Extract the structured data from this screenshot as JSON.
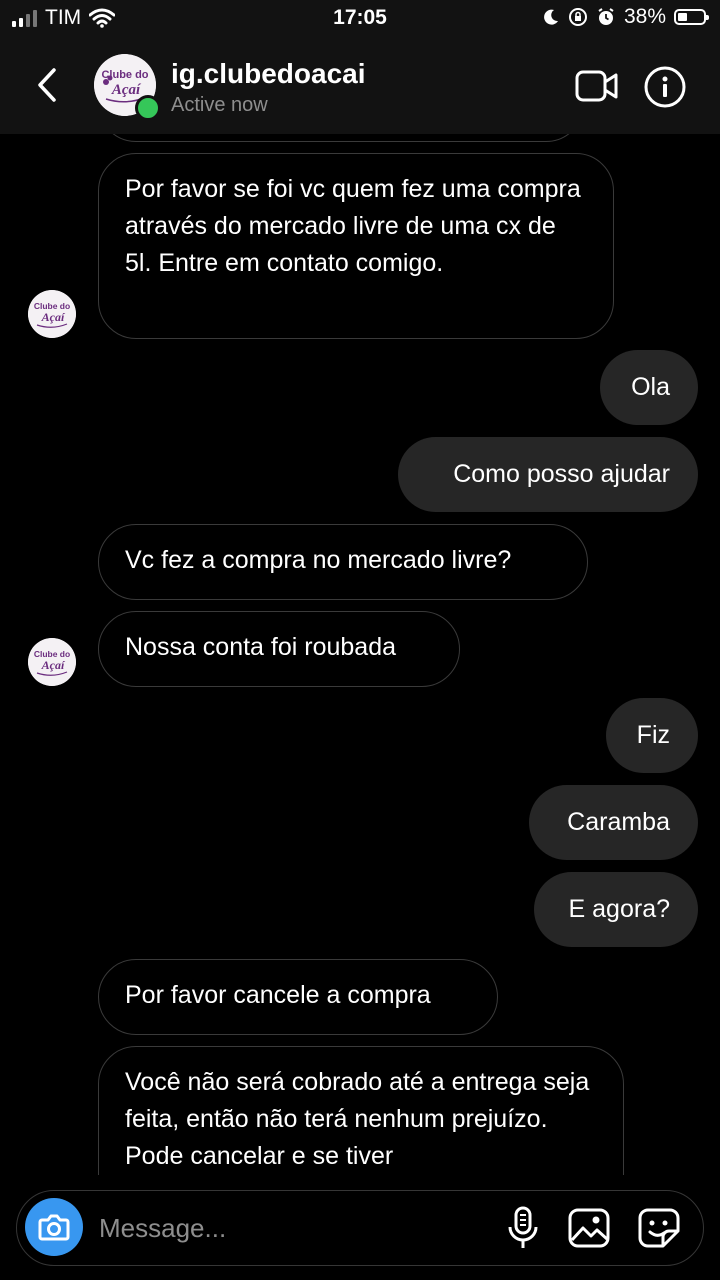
{
  "status_bar": {
    "carrier": "TIM",
    "time": "17:05",
    "battery": "38%",
    "battery_level": 0.38
  },
  "header": {
    "username": "ig.clubedoacai",
    "status": "Active now",
    "logo_text_top": "Clube do",
    "logo_text_bottom": "Açaí"
  },
  "messages": [
    {
      "from": "them",
      "text": "Por favor se foi vc quem fez uma compra através do mercado livre de uma cx de 5l. Entre em contato comigo."
    },
    {
      "from": "me",
      "text": "Ola"
    },
    {
      "from": "me",
      "text": "Como posso ajudar"
    },
    {
      "from": "them",
      "text": "Vc fez a compra no mercado livre?"
    },
    {
      "from": "them",
      "text": "Nossa conta foi roubada"
    },
    {
      "from": "me",
      "text": "Fiz"
    },
    {
      "from": "me",
      "text": "Caramba"
    },
    {
      "from": "me",
      "text": "E agora?"
    },
    {
      "from": "them",
      "text": "Por favor cancele a compra"
    },
    {
      "from": "them",
      "text": "Você não será cobrado até a entrega seja feita, então não terá nenhum prejuízo. Pode cancelar e se tiver"
    }
  ],
  "composer": {
    "placeholder": "Message..."
  },
  "colors": {
    "background": "#000000",
    "header_bg": "#121212",
    "outgoing_bubble": "#262626",
    "incoming_border": "#3a3a3a",
    "online": "#35c759",
    "camera_button": "#3897f0",
    "brand_purple": "#6b2d7f"
  }
}
